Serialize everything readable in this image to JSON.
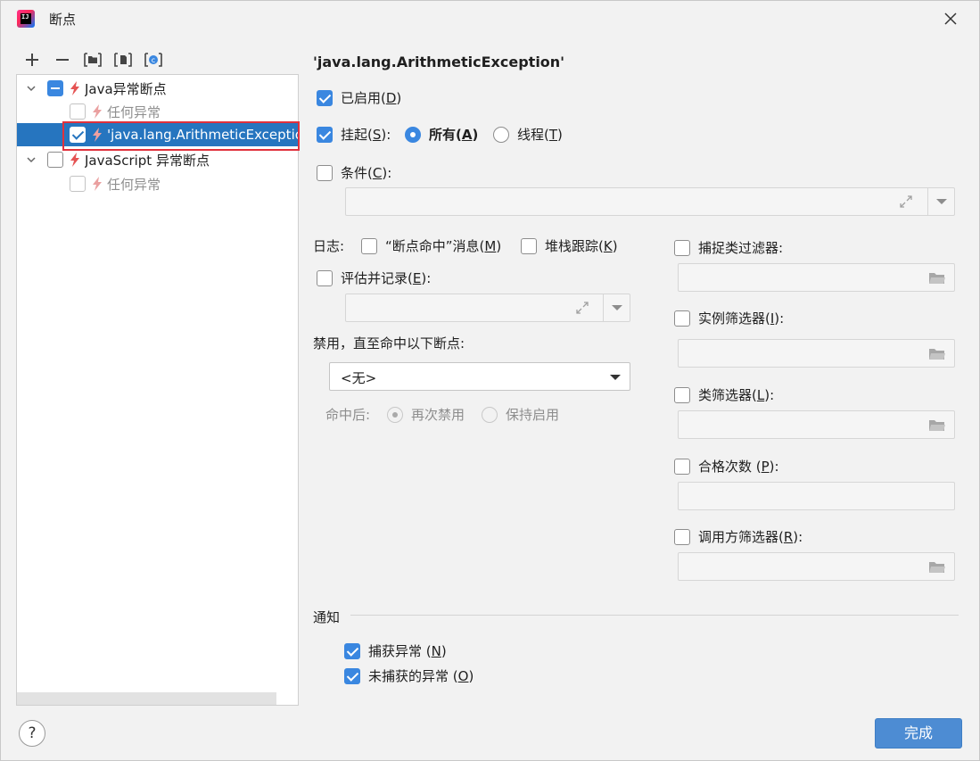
{
  "window": {
    "title": "断点",
    "app_icon_text": "IJ"
  },
  "toolbar": {
    "add": "+",
    "remove": "−"
  },
  "tree": {
    "nodes": [
      {
        "label": "Java异常断点",
        "state": "partial",
        "expanded": true
      },
      {
        "label": "任何异常",
        "state": "unchecked",
        "disabled": true
      },
      {
        "label": "'java.lang.ArithmeticExceptio",
        "state": "checked",
        "selected": true
      },
      {
        "label": "JavaScript 异常断点",
        "state": "unchecked",
        "expanded": true
      },
      {
        "label": "任何异常",
        "state": "unchecked",
        "disabled": true
      }
    ]
  },
  "detail": {
    "heading": "'java.lang.ArithmeticException'",
    "enabled": {
      "label_pre": "已启用(",
      "mnemonic": "D",
      "label_post": ")",
      "checked": true
    },
    "suspend": {
      "label_pre": "挂起(",
      "mnemonic": "S",
      "label_post": "):",
      "checked": true,
      "all": {
        "label_pre": "所有(",
        "mnemonic": "A",
        "label_post": ")",
        "on": true
      },
      "thread": {
        "label_pre": "线程(",
        "mnemonic": "T",
        "label_post": ")",
        "on": false
      }
    },
    "condition": {
      "label_pre": "条件(",
      "mnemonic": "C",
      "label_post": "):",
      "checked": false,
      "value": ""
    },
    "log": {
      "label": "日志:",
      "hit_message": {
        "label_pre": "“断点命中”消息(",
        "mnemonic": "M",
        "label_post": ")",
        "checked": false
      },
      "stack_trace": {
        "label_pre": "堆栈跟踪(",
        "mnemonic": "K",
        "label_post": ")",
        "checked": false
      }
    },
    "evaluate": {
      "label_pre": "评估并记录(",
      "mnemonic": "E",
      "label_post": "):",
      "checked": false,
      "value": ""
    },
    "disable_until": {
      "label": "禁用，直至命中以下断点:",
      "selected": "<无>"
    },
    "after_hit": {
      "label": "命中后:",
      "disable_again": {
        "label": "再次禁用",
        "on": true
      },
      "keep_enabled": {
        "label": "保持启用",
        "on": false
      }
    },
    "filters": {
      "catch_class": {
        "label": "捕捉类过滤器:",
        "checked": false,
        "value": ""
      },
      "instance": {
        "label_pre": "实例筛选器(",
        "mnemonic": "I",
        "label_post": "):",
        "checked": false,
        "value": ""
      },
      "class": {
        "label_pre": "类筛选器(",
        "mnemonic": "L",
        "label_post": "):",
        "checked": false,
        "value": ""
      },
      "pass_count": {
        "label_pre": "合格次数 (",
        "mnemonic": "P",
        "label_post": "):",
        "checked": false,
        "value": ""
      },
      "caller": {
        "label_pre": "调用方筛选器(",
        "mnemonic": "R",
        "label_post": "):",
        "checked": false,
        "value": ""
      }
    },
    "notifications": {
      "section": "通知",
      "caught": {
        "label_pre": "捕获异常 (",
        "mnemonic": "N",
        "label_post": ")",
        "checked": true
      },
      "uncaught": {
        "label_pre": "未捕获的异常 (",
        "mnemonic": "O",
        "label_post": ")",
        "checked": true
      }
    }
  },
  "footer": {
    "help": "?",
    "done": "完成"
  },
  "colors": {
    "accent": "#3a87e0",
    "selection": "#2675bf",
    "highlight_border": "#e0313c",
    "bolt": "#e55353"
  }
}
